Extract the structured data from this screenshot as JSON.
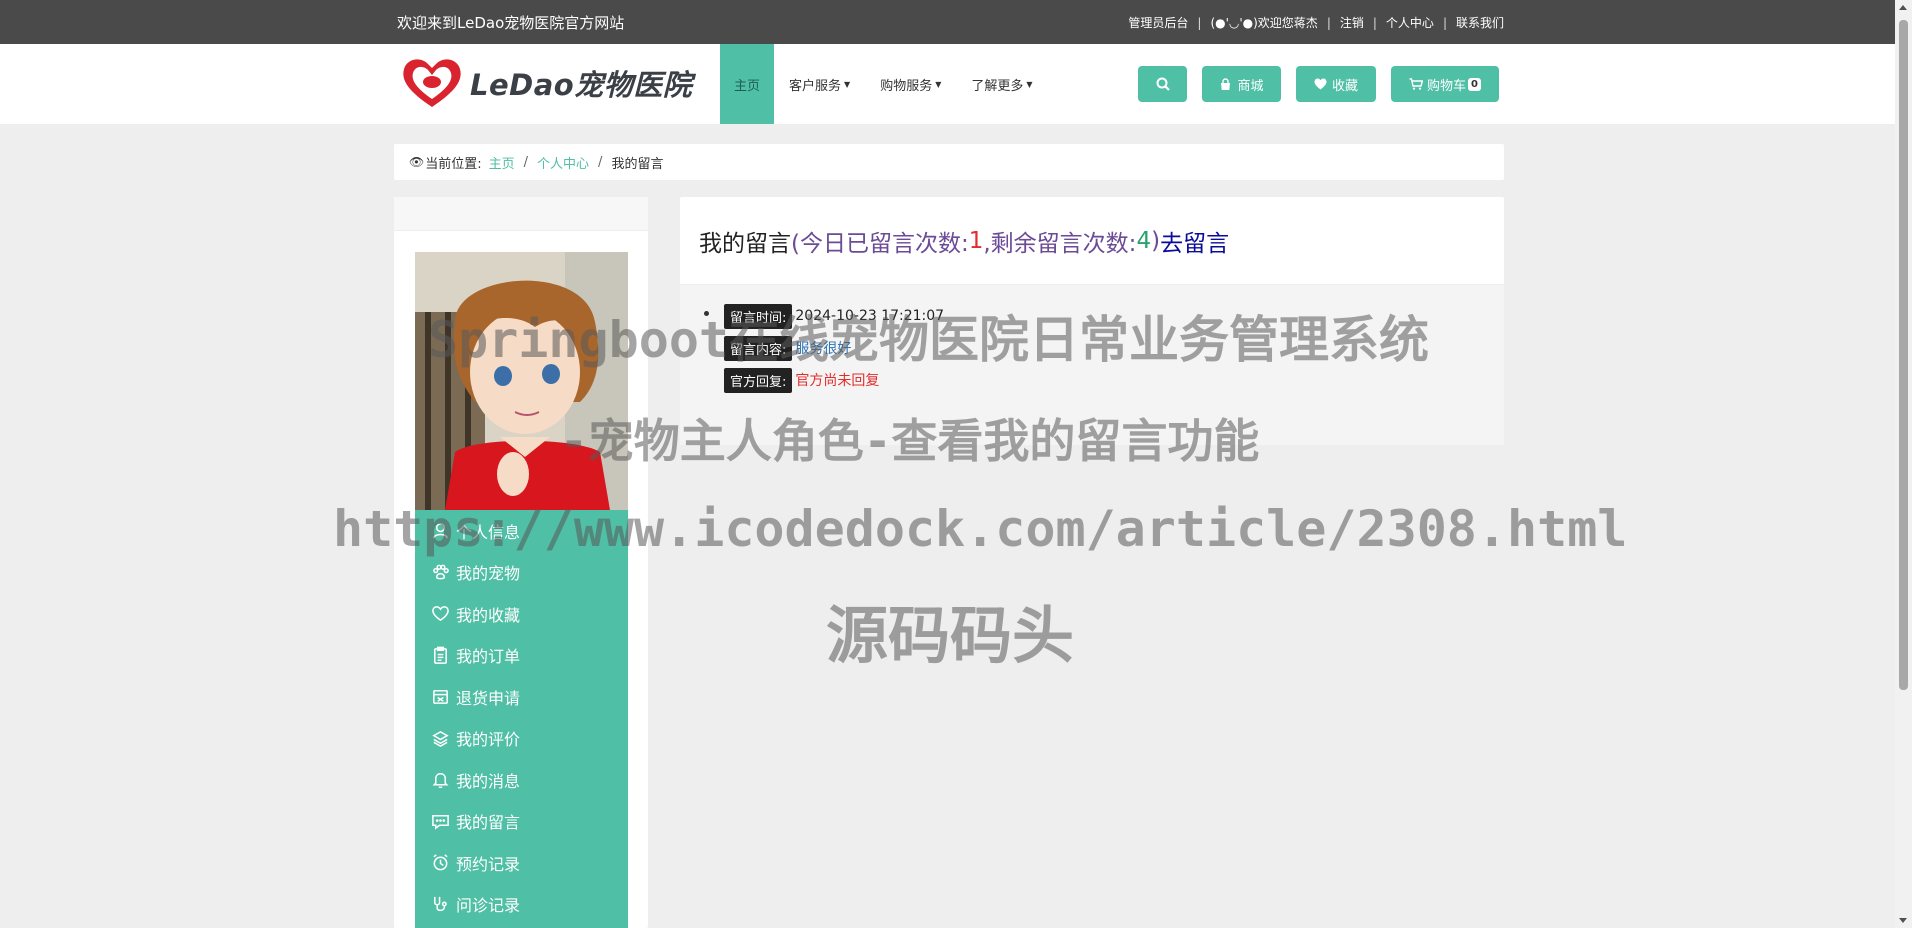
{
  "topbar": {
    "welcome": "欢迎来到LeDao宠物医院官方网站",
    "links": [
      "管理员后台",
      "(●'◡'●)欢迎您蒋杰",
      "注销",
      "个人中心",
      "联系我们"
    ]
  },
  "logo": {
    "text": "LeDao宠物医院"
  },
  "nav": {
    "menu": [
      {
        "label": "主页",
        "active": true,
        "dropdown": false
      },
      {
        "label": "客户服务",
        "active": false,
        "dropdown": true
      },
      {
        "label": "购物服务",
        "active": false,
        "dropdown": true
      },
      {
        "label": "了解更多",
        "active": false,
        "dropdown": true
      }
    ],
    "buttons": {
      "mall": "商城",
      "favorite": "收藏",
      "cart": "购物车",
      "cart_count": "0"
    }
  },
  "breadcrumb": {
    "prefix": "当前位置:",
    "items": [
      "主页",
      "个人中心",
      "我的留言"
    ]
  },
  "sidebar": {
    "items": [
      {
        "label": "个人信息",
        "icon": "user-icon"
      },
      {
        "label": "我的宠物",
        "icon": "paw-icon"
      },
      {
        "label": "我的收藏",
        "icon": "heart-icon"
      },
      {
        "label": "我的订单",
        "icon": "clipboard-icon"
      },
      {
        "label": "退货申请",
        "icon": "return-box-icon"
      },
      {
        "label": "我的评价",
        "icon": "review-icon"
      },
      {
        "label": "我的消息",
        "icon": "bell-icon"
      },
      {
        "label": "我的留言",
        "icon": "chat-icon"
      },
      {
        "label": "预约记录",
        "icon": "alarm-clock-icon"
      },
      {
        "label": "问诊记录",
        "icon": "stethoscope-icon"
      }
    ]
  },
  "main": {
    "title": "我的留言",
    "open_paren": "(今日已留言次数:",
    "today_count": "1",
    "remaining_label": ",剩余留言次数:",
    "remaining_count": "4",
    "close_paren": ")",
    "go_link": "去留言",
    "message": {
      "time_label": "留言时间:",
      "time": "2024-10-23 17:21:07",
      "content_label": "留言内容:",
      "content": "服务很好",
      "reply_label": "官方回复:",
      "reply": "官方尚未回复"
    }
  },
  "watermark": {
    "line1": "Springboot在线宠物医院日常业务管理系统",
    "line2": "-宠物主人角色-查看我的留言功能",
    "line3": "https://www.icodedock.com/article/2308.html",
    "line4": "源码码头"
  },
  "colors": {
    "accent": "#4fbfa5",
    "topbar": "#4a4a4a",
    "highlight_red": "#e32d2d",
    "link_blue": "#2e75b6"
  }
}
